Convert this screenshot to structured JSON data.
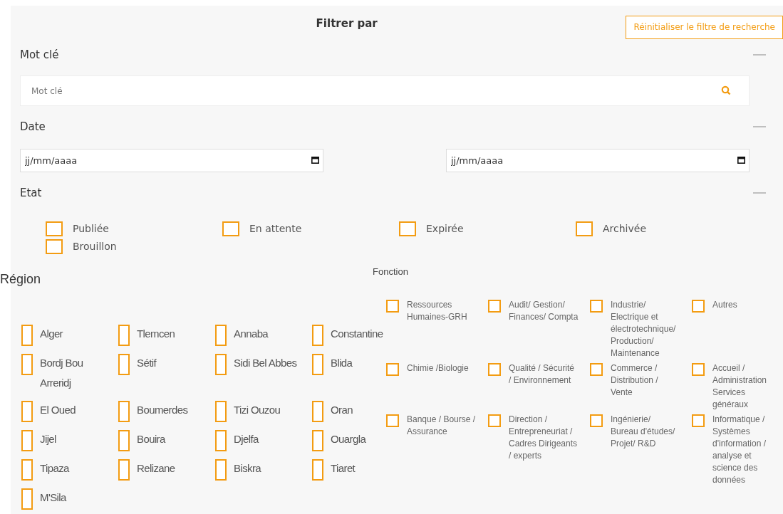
{
  "header": {
    "title": "Filtrer par",
    "reset_button": "Réinitialiser le filtre de recherche"
  },
  "keyword": {
    "title": "Mot clé",
    "expanded": true,
    "placeholder": "Mot clé"
  },
  "date": {
    "title": "Date",
    "expanded": true,
    "fields": [
      {
        "placeholder": "jj/mm/aaaa"
      },
      {
        "placeholder": "jj/mm/aaaa"
      }
    ]
  },
  "state": {
    "title": "Etat",
    "expanded": true,
    "options": [
      {
        "label": "Publiée",
        "checked": false
      },
      {
        "label": "En attente",
        "checked": false
      },
      {
        "label": "Expirée",
        "checked": false
      },
      {
        "label": "Archivée",
        "checked": false
      },
      {
        "label": "Brouillon",
        "checked": false
      }
    ]
  },
  "region": {
    "title": "Région",
    "options": [
      {
        "label": "Alger",
        "checked": false
      },
      {
        "label": "Tlemcen",
        "checked": false
      },
      {
        "label": "Annaba",
        "checked": false
      },
      {
        "label": "Constantine",
        "checked": false
      },
      {
        "label": "Bordj Bou Arreridj",
        "checked": false
      },
      {
        "label": "Sétif",
        "checked": false
      },
      {
        "label": "Sidi Bel Abbes",
        "checked": false
      },
      {
        "label": "Blida",
        "checked": false
      },
      {
        "label": "El Oued",
        "checked": false
      },
      {
        "label": "Boumerdes",
        "checked": false
      },
      {
        "label": "Tizi Ouzou",
        "checked": false
      },
      {
        "label": "Oran",
        "checked": false
      },
      {
        "label": "Jijel",
        "checked": false
      },
      {
        "label": "Bouira",
        "checked": false
      },
      {
        "label": "Djelfa",
        "checked": false
      },
      {
        "label": "Ouargla",
        "checked": false
      },
      {
        "label": "Tipaza",
        "checked": false
      },
      {
        "label": "Relizane",
        "checked": false
      },
      {
        "label": "Biskra",
        "checked": false
      },
      {
        "label": "Tiaret",
        "checked": false
      },
      {
        "label": "M'Sila",
        "checked": false
      }
    ]
  },
  "function": {
    "title": "Fonction",
    "options": [
      {
        "label": "Ressources Humaines-GRH",
        "checked": false
      },
      {
        "label": "Audit/ Gestion/ Finances/ Compta",
        "checked": false
      },
      {
        "label": "Industrie/ Electrique et électrotechnique/ Production/ Maintenance",
        "checked": false
      },
      {
        "label": "Autres",
        "checked": false
      },
      {
        "label": "Chimie /Biologie",
        "checked": false
      },
      {
        "label": "Qualité / Sécurité / Environnement",
        "checked": false
      },
      {
        "label": "Commerce / Distribution / Vente",
        "checked": false
      },
      {
        "label": "Accueil / Administration Services généraux",
        "checked": false
      },
      {
        "label": "Banque / Bourse / Assurance",
        "checked": false
      },
      {
        "label": "Direction / Entrepreneuriat / Cadres Dirigeants / experts",
        "checked": false
      },
      {
        "label": "Ingénierie/ Bureau d'études/ Projet/ R&D",
        "checked": false
      },
      {
        "label": "Informatique / Systèmes d'information / analyse et science des données",
        "checked": false
      }
    ]
  }
}
